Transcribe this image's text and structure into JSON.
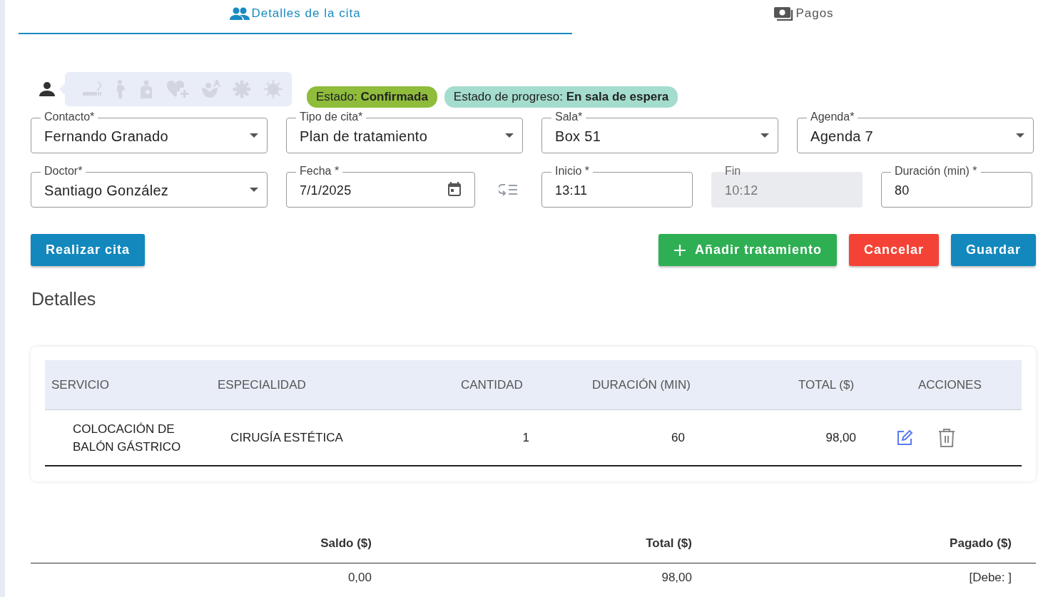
{
  "tabs": [
    {
      "label": "Detalles de la cita",
      "kind": "appointment",
      "selected": true
    },
    {
      "label": "Pagos",
      "kind": "payments",
      "selected": false
    }
  ],
  "conditions": [
    {
      "kind": "smoking",
      "active": false
    },
    {
      "kind": "pregnant",
      "active": false
    },
    {
      "kind": "baby",
      "active": false
    },
    {
      "kind": "heart",
      "active": false
    },
    {
      "kind": "allergy",
      "active": false
    },
    {
      "kind": "bacteria",
      "active": false
    },
    {
      "kind": "virus",
      "active": false
    }
  ],
  "badges": [
    {
      "label": "Estado:",
      "value": "Confirmada",
      "color": "#8fbc3b"
    },
    {
      "label": "Estado de progreso:",
      "value": "En sala de espera",
      "color": "#a4dccd"
    }
  ],
  "fields_row_1": [
    {
      "label": "Contacto*",
      "value": "Fernando Granado",
      "kind": "select",
      "disabled": false
    },
    {
      "label": "Tipo de cita*",
      "value": "Plan de tratamiento",
      "kind": "select",
      "disabled": false
    },
    {
      "label": "Sala*",
      "value": "Box 51",
      "kind": "select",
      "disabled": false
    },
    {
      "label": "Agenda*",
      "value": "Agenda 7",
      "kind": "select",
      "disabled": false
    }
  ],
  "fields_row_2": [
    {
      "label": "Doctor*",
      "value": "Santiago González",
      "kind": "select",
      "disabled": false
    },
    {
      "label": "Fecha *",
      "value": "7/1/2025",
      "kind": "date",
      "disabled": false
    },
    {
      "kind": "action"
    },
    {
      "label": "Inicio *",
      "value": "13:11",
      "kind": "text",
      "disabled": false
    },
    {
      "label": "Fin",
      "value": "10:12",
      "kind": "text",
      "disabled": true
    },
    {
      "label": "Duración (min) *",
      "value": "80",
      "kind": "text",
      "disabled": false
    }
  ],
  "buttons_left": [
    {
      "label": "Realizar cita",
      "kind": "primary"
    }
  ],
  "buttons_right": [
    {
      "label": "Añadir tratamiento",
      "kind": "add"
    },
    {
      "label": "Cancelar",
      "kind": "danger"
    },
    {
      "label": "Guardar",
      "kind": "primary"
    }
  ],
  "section_title": "Detalles",
  "table": {
    "columns": [
      "SERVICIO",
      "ESPECIALIDAD",
      "CANTIDAD",
      "DURACIÓN (MIN)",
      "TOTAL ($)",
      "ACCIONES"
    ],
    "rows": [
      {
        "servicio": "COLOCACIÓN DE BALÓN GÁSTRICO",
        "especialidad": "CIRUGÍA ESTÉTICA",
        "cantidad": "1",
        "duracion": "60",
        "total": "98,00"
      }
    ]
  },
  "summary": {
    "columns": [
      "Saldo ($)",
      "Total ($)",
      "Pagado ($)"
    ],
    "values": [
      "0,00",
      "98,00",
      "[Debe: ]"
    ]
  }
}
